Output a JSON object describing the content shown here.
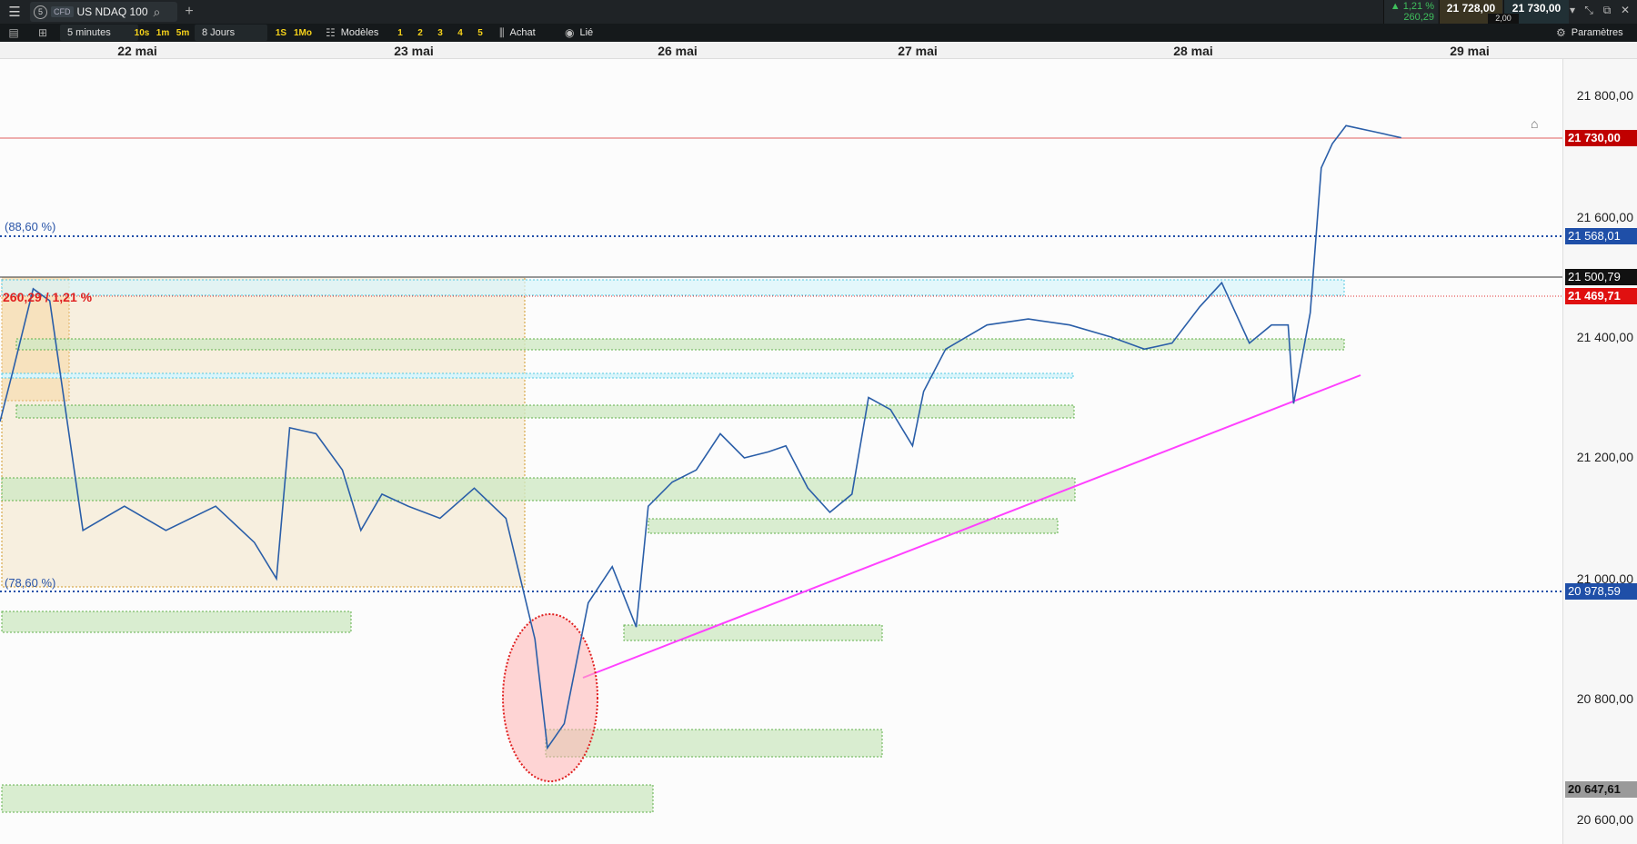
{
  "titlebar": {
    "instrument_badge": "5",
    "instrument_type": "CFD",
    "instrument_name": "US NDAQ 100",
    "change_percent": "▲ 1,21 %",
    "change_points": "260,29",
    "bid": "21 728,00",
    "ask": "21 730,00",
    "spread": "2,00"
  },
  "toolbar": {
    "timeframe": "5 minutes",
    "intervals": [
      "10s",
      "1m",
      "5m"
    ],
    "range": "8 Jours",
    "periods": [
      "1S",
      "1Mo"
    ],
    "templates_label": "Modèles",
    "numbers": [
      "1",
      "2",
      "3",
      "4",
      "5"
    ],
    "buy_label": "Achat",
    "linked_label": "Lié",
    "settings_label": "Paramètres"
  },
  "chart_data": {
    "type": "line",
    "title": "",
    "days": [
      "22 mai",
      "23 mai",
      "26 mai",
      "27 mai",
      "28 mai",
      "29 mai"
    ],
    "y_ticks": [
      "21 800,00",
      "21 600,00",
      "21 400,00",
      "21 200,00",
      "21 000,00",
      "20 800,00",
      "20 600,00"
    ],
    "ylim": [
      20580,
      21870
    ],
    "series": [
      {
        "x_day_index": [
          0.0,
          0.05,
          0.12,
          0.18,
          0.3,
          0.45,
          0.6,
          0.78,
          0.92,
          1.0,
          1.05,
          1.15,
          1.25,
          1.32,
          1.4,
          1.5,
          1.62,
          1.75,
          1.87,
          1.98,
          2.03,
          2.1,
          2.2,
          2.3,
          2.4,
          2.45,
          2.55,
          2.65,
          2.75,
          2.85,
          2.95,
          3.02,
          3.1,
          3.18,
          3.26,
          3.32,
          3.4,
          3.48,
          3.52,
          3.6,
          3.75,
          3.9,
          4.05,
          4.2,
          4.32,
          4.42,
          4.52,
          4.6,
          4.7,
          4.78,
          4.84,
          4.86,
          4.92,
          4.96,
          5.0,
          5.05,
          5.15,
          5.25
        ],
        "values": [
          21260,
          21350,
          21480,
          21460,
          21080,
          21120,
          21080,
          21120,
          21060,
          21000,
          21250,
          21240,
          21180,
          21080,
          21140,
          21120,
          21100,
          21150,
          21100,
          20900,
          20720,
          20760,
          20960,
          21020,
          20920,
          21120,
          21160,
          21180,
          21240,
          21200,
          21210,
          21220,
          21150,
          21110,
          21140,
          21300,
          21280,
          21220,
          21310,
          21380,
          21420,
          21430,
          21420,
          21400,
          21380,
          21390,
          21450,
          21490,
          21390,
          21420,
          21420,
          21290,
          21440,
          21680,
          21720,
          21750,
          21740,
          21730
        ]
      }
    ],
    "reference_levels": [
      {
        "label": "21 730,00",
        "value": 21730
      },
      {
        "label": "21 568,01",
        "value": 21568.01,
        "note": "(88,60 %)"
      },
      {
        "label": "21 500,79",
        "value": 21500.79
      },
      {
        "label": "21 469,71",
        "value": 21469.71
      },
      {
        "label": "20 978,59",
        "value": 20978.59,
        "note": "(78,60 %)"
      },
      {
        "label": "20 647,61",
        "value": 20647.61
      }
    ],
    "performance_label": "260,29 / 1,21 %"
  }
}
